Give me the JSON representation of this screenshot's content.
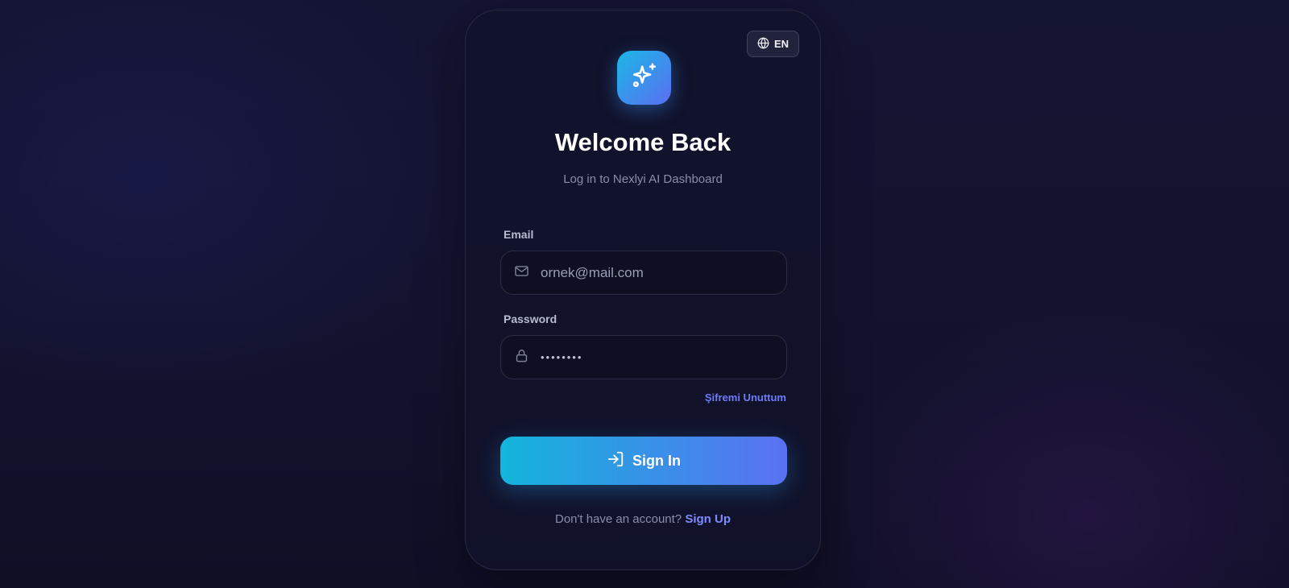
{
  "language": {
    "code": "EN",
    "icon": "globe-icon"
  },
  "brand": {
    "logo_icon": "sparkles-icon",
    "accent_from": "#1bb7e6",
    "accent_to": "#5a6ef2"
  },
  "header": {
    "title": "Welcome Back",
    "subtitle": "Log in to Nexlyi AI Dashboard"
  },
  "form": {
    "email": {
      "label": "Email",
      "placeholder": "ornek@mail.com",
      "icon": "mail-icon"
    },
    "password": {
      "label": "Password",
      "value": "••••••••",
      "icon": "lock-icon"
    },
    "forgot_link": "Şifremi Unuttum",
    "submit": {
      "label": "Sign In",
      "icon": "log-in-icon"
    }
  },
  "footer": {
    "prompt": "Don't have an account?",
    "link": "Sign Up"
  }
}
